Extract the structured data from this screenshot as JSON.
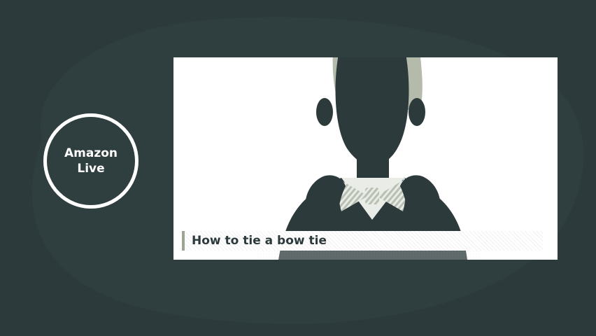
{
  "badge": {
    "line1": "Amazon",
    "line2": "Live"
  },
  "video": {
    "caption": "How to tie a bow tie"
  },
  "colors": {
    "background": "#2c3a3b",
    "blob": "#2f3d3e",
    "accent": "#9aa693",
    "white": "#ffffff"
  }
}
